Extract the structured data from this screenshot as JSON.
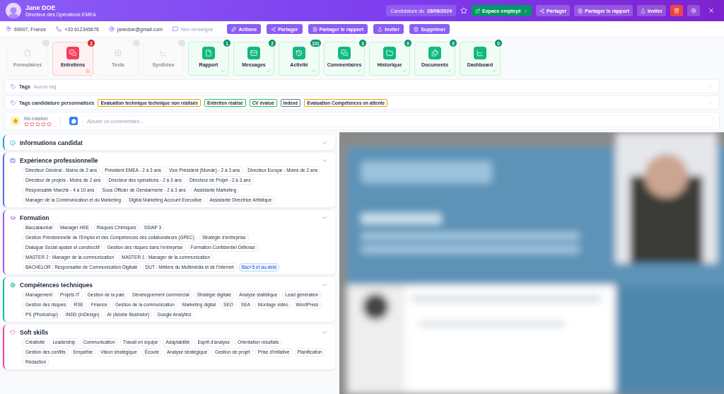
{
  "header": {
    "name": "Jane DOE",
    "role": "Directeur des Opérations EMEA",
    "candidature_label": "Candidature du",
    "candidature_date": "28/06/2024",
    "favorite": false,
    "buttons": [
      {
        "kind": "green",
        "label": "Espace employé"
      },
      {
        "kind": "share",
        "label": "Partager"
      },
      {
        "kind": "report",
        "label": "Partager le rapport"
      },
      {
        "kind": "invite",
        "label": "Inviter"
      },
      {
        "kind": "delete"
      },
      {
        "kind": "settings"
      },
      {
        "kind": "close"
      }
    ]
  },
  "contact": {
    "items": [
      {
        "kind": "location",
        "text": "69007, France",
        "empty": false
      },
      {
        "kind": "phone",
        "text": "+33 612345678",
        "empty": false
      },
      {
        "kind": "email",
        "text": "janedoe@gmail.com",
        "empty": false
      },
      {
        "kind": "messenger",
        "text": "Non renseigné",
        "empty": true
      }
    ],
    "actions": [
      {
        "kind": "actions",
        "label": "Actions"
      },
      {
        "kind": "share",
        "label": "Partager"
      },
      {
        "kind": "report",
        "label": "Partager le rapport"
      },
      {
        "kind": "invite",
        "label": "Inviter"
      },
      {
        "kind": "delete",
        "label": "Supprimer"
      }
    ]
  },
  "tiles": [
    {
      "label": "Formulaires",
      "kind": "disabled"
    },
    {
      "label": "Entretiens",
      "kind": "alert",
      "badge": "2"
    },
    {
      "label": "Tests",
      "kind": "disabled"
    },
    {
      "label": "Synthèse",
      "kind": "disabled"
    },
    {
      "label": "Rapport",
      "kind": "done",
      "badge": "1"
    },
    {
      "label": "Messages",
      "kind": "done",
      "badge": "2"
    },
    {
      "label": "Activité",
      "kind": "done",
      "badge": "101"
    },
    {
      "label": "Commentaires",
      "kind": "done",
      "badge": "3"
    },
    {
      "label": "Historique",
      "kind": "done",
      "badge": "0"
    },
    {
      "label": "Documents",
      "kind": "done",
      "badge": "0"
    },
    {
      "label": "Dashboard",
      "kind": "done",
      "badge": "0"
    }
  ],
  "tags": {
    "label": "Tags",
    "placeholder": "Aucun tag"
  },
  "custom_tags": {
    "label": "Tags candidature personnalisés",
    "items": [
      {
        "label": "Evaluation technique technique non réalisée",
        "color": "#f59e0b"
      },
      {
        "label": "Entretien réalisé",
        "color": "#22c55e"
      },
      {
        "label": "CV évalué",
        "color": "#22c55e"
      },
      {
        "label": "Indexé",
        "color": "#64748b"
      },
      {
        "label": "Evaluation Compétences en attente",
        "color": "#f59e0b"
      }
    ]
  },
  "rating": {
    "label": "Ma notation",
    "stars": 0
  },
  "comment": {
    "placeholder": "Ajouter un commentaire..."
  },
  "sections": [
    {
      "title": "Informations candidat",
      "color": "#0ea5e9"
    },
    {
      "title": "Expérience professionnelle",
      "color": "#6366f1",
      "chips": [
        {
          "label": "Directeur Général - Moins de 2 ans",
          "highlighted": false
        },
        {
          "label": "Président EMEA - 2 à 3 ans",
          "highlighted": false
        },
        {
          "label": "Vice Président (Monde) - 2 à 3 ans",
          "highlighted": false
        },
        {
          "label": "Directeur Europe - Moins de 2 ans",
          "highlighted": false
        },
        {
          "label": "Directeur de projets - Moins de 2 ans",
          "highlighted": false
        },
        {
          "label": "Directeur des opérations - 2 à 3 ans",
          "highlighted": false
        },
        {
          "label": "Directeur de Projet - 2 à 3 ans",
          "highlighted": false
        },
        {
          "label": "Responsable Marché - 4 à 10 ans",
          "highlighted": false
        },
        {
          "label": "Sous Officier de Gendarmerie - 2 à 3 ans",
          "highlighted": false
        },
        {
          "label": "Assistante Marketing",
          "highlighted": false
        },
        {
          "label": "Manager de la Communication et du Marketing",
          "highlighted": false
        },
        {
          "label": "Digital Marketing Account Executive",
          "highlighted": false
        },
        {
          "label": "Assistante Directrice Artistique",
          "highlighted": false
        }
      ]
    },
    {
      "title": "Formation",
      "color": "#a855f7",
      "chips": [
        {
          "label": "Baccalauréat",
          "highlighted": false
        },
        {
          "label": "Manager HSE",
          "highlighted": false
        },
        {
          "label": "Risques Chimiques",
          "highlighted": false
        },
        {
          "label": "SSIAP 3",
          "highlighted": false
        },
        {
          "label": "Gestion Prévisionnelle de l'Emploi et des Compétences des collaborateurs (GPEC)",
          "highlighted": false
        },
        {
          "label": "Stratégie d'entreprise",
          "highlighted": false
        },
        {
          "label": "Dialogue Social apaisé et constructif",
          "highlighted": false
        },
        {
          "label": "Gestion des risques dans l'entreprise",
          "highlighted": false
        },
        {
          "label": "Formation Confidentiel Défense",
          "highlighted": false
        },
        {
          "label": "MASTER 2 : Manager de la communication",
          "highlighted": false
        },
        {
          "label": "MASTER 1 : Manager de la communication",
          "highlighted": false
        },
        {
          "label": "BACHELOR : Responsable de Communication Digitale",
          "highlighted": false
        },
        {
          "label": "DUT : Métiers du Multimédia et de l'Internet",
          "highlighted": false
        },
        {
          "label": "Bac+5 et au-delà",
          "highlighted": true
        }
      ]
    },
    {
      "title": "Compétences techniques",
      "color": "#14b8a6",
      "chips": [
        {
          "label": "Management",
          "highlighted": false
        },
        {
          "label": "Projets IT",
          "highlighted": false
        },
        {
          "label": "Gestion de la paie",
          "highlighted": false
        },
        {
          "label": "Développement commercial",
          "highlighted": false
        },
        {
          "label": "Stratégie digitale",
          "highlighted": false
        },
        {
          "label": "Analyse statistique",
          "highlighted": false
        },
        {
          "label": "Lead génération",
          "highlighted": false
        },
        {
          "label": "Gestion des risques",
          "highlighted": false
        },
        {
          "label": "RSE",
          "highlighted": false
        },
        {
          "label": "Finance",
          "highlighted": false
        },
        {
          "label": "Gestion de la communication",
          "highlighted": false
        },
        {
          "label": "Marketing digital",
          "highlighted": false
        },
        {
          "label": "SEO",
          "highlighted": false
        },
        {
          "label": "SEA",
          "highlighted": false
        },
        {
          "label": "Montage vidéo",
          "highlighted": false
        },
        {
          "label": "WordPress",
          "highlighted": false
        },
        {
          "label": "PS (Photoshop)",
          "highlighted": false
        },
        {
          "label": "INDD (InDesign)",
          "highlighted": false
        },
        {
          "label": "AI (Adobe Illustrator)",
          "highlighted": false
        },
        {
          "label": "Google Analytics",
          "highlighted": false
        }
      ]
    },
    {
      "title": "Soft skills",
      "color": "#ec4899",
      "chips": [
        {
          "label": "Créativité",
          "highlighted": false
        },
        {
          "label": "Leadership",
          "highlighted": false
        },
        {
          "label": "Communication",
          "highlighted": false
        },
        {
          "label": "Travail en équipe",
          "highlighted": false
        },
        {
          "label": "Adaptabilité",
          "highlighted": false
        },
        {
          "label": "Esprit d'analyse",
          "highlighted": false
        },
        {
          "label": "Orientation résultats",
          "highlighted": false
        },
        {
          "label": "Gestion des conflits",
          "highlighted": false
        },
        {
          "label": "Empathie",
          "highlighted": false
        },
        {
          "label": "Vision stratégique",
          "highlighted": false
        },
        {
          "label": "Écoute",
          "highlighted": false
        },
        {
          "label": "Analyse stratégique",
          "highlighted": false
        },
        {
          "label": "Gestion de projet",
          "highlighted": false
        },
        {
          "label": "Prise d'initiative",
          "highlighted": false
        },
        {
          "label": "Planification",
          "highlighted": false
        },
        {
          "label": "Rédaction",
          "highlighted": false
        }
      ]
    }
  ]
}
